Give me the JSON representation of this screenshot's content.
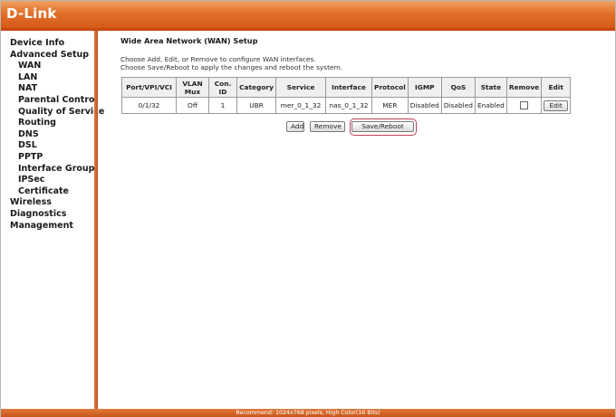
{
  "brand": {
    "logo_text": "D-Link",
    "accent": "#e2702a"
  },
  "sidebar": {
    "items": [
      {
        "label": "Device Info",
        "sub": false
      },
      {
        "label": "Advanced Setup",
        "sub": false
      },
      {
        "label": "WAN",
        "sub": true
      },
      {
        "label": "LAN",
        "sub": true
      },
      {
        "label": "NAT",
        "sub": true
      },
      {
        "label": "Parental Control",
        "sub": true
      },
      {
        "label": "Quality of Service",
        "sub": true
      },
      {
        "label": "Routing",
        "sub": true
      },
      {
        "label": "DNS",
        "sub": true
      },
      {
        "label": "DSL",
        "sub": true
      },
      {
        "label": "PPTP",
        "sub": true
      },
      {
        "label": "Interface Group",
        "sub": true
      },
      {
        "label": "IPSec",
        "sub": true
      },
      {
        "label": "Certificate",
        "sub": true
      },
      {
        "label": "Wireless",
        "sub": false
      },
      {
        "label": "Diagnostics",
        "sub": false
      },
      {
        "label": "Management",
        "sub": false
      }
    ]
  },
  "main": {
    "title": "Wide Area Network (WAN) Setup",
    "desc_line1": "Choose Add, Edit, or Remove to configure WAN interfaces.",
    "desc_line2": "Choose Save/Reboot to apply the changes and reboot the system."
  },
  "table": {
    "headers": {
      "port": "Port/VPI/VCI",
      "vlan_line1": "VLAN",
      "vlan_line2": "Mux",
      "conid_line1": "Con.",
      "conid_line2": "ID",
      "category": "Category",
      "service": "Service",
      "interface": "Interface",
      "protocol": "Protocol",
      "igmp": "IGMP",
      "qos": "QoS",
      "state": "State",
      "remove": "Remove",
      "edit": "Edit"
    },
    "rows": [
      {
        "port": "0/1/32",
        "vlan_mux": "Off",
        "con_id": "1",
        "category": "UBR",
        "service": "mer_0_1_32",
        "interface": "nas_0_1_32",
        "protocol": "MER",
        "igmp": "Disabled",
        "qos": "Disabled",
        "state": "Enabled",
        "remove_checked": false,
        "edit_label": "Edit"
      }
    ]
  },
  "buttons": {
    "add": "Add",
    "remove": "Remove",
    "save_reboot": "Save/Reboot"
  },
  "footer": {
    "text": "Recommend: 1024x768 pixels, High Color(16 Bits)"
  }
}
